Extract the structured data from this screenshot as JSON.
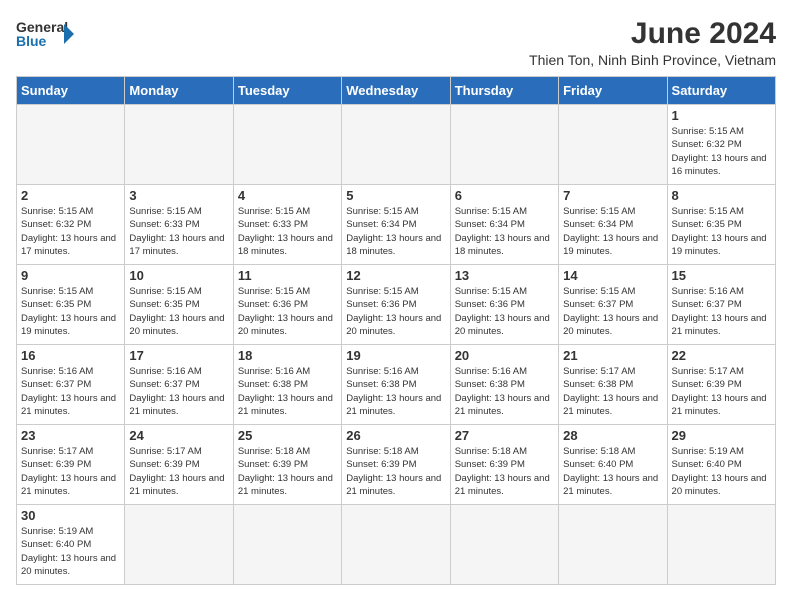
{
  "header": {
    "logo_general": "General",
    "logo_blue": "Blue",
    "title": "June 2024",
    "subtitle": "Thien Ton, Ninh Binh Province, Vietnam"
  },
  "days_of_week": [
    "Sunday",
    "Monday",
    "Tuesday",
    "Wednesday",
    "Thursday",
    "Friday",
    "Saturday"
  ],
  "weeks": [
    [
      {
        "day": "",
        "info": ""
      },
      {
        "day": "",
        "info": ""
      },
      {
        "day": "",
        "info": ""
      },
      {
        "day": "",
        "info": ""
      },
      {
        "day": "",
        "info": ""
      },
      {
        "day": "",
        "info": ""
      },
      {
        "day": "1",
        "info": "Sunrise: 5:15 AM\nSunset: 6:32 PM\nDaylight: 13 hours and 16 minutes."
      }
    ],
    [
      {
        "day": "2",
        "info": "Sunrise: 5:15 AM\nSunset: 6:32 PM\nDaylight: 13 hours and 17 minutes."
      },
      {
        "day": "3",
        "info": "Sunrise: 5:15 AM\nSunset: 6:33 PM\nDaylight: 13 hours and 17 minutes."
      },
      {
        "day": "4",
        "info": "Sunrise: 5:15 AM\nSunset: 6:33 PM\nDaylight: 13 hours and 18 minutes."
      },
      {
        "day": "5",
        "info": "Sunrise: 5:15 AM\nSunset: 6:34 PM\nDaylight: 13 hours and 18 minutes."
      },
      {
        "day": "6",
        "info": "Sunrise: 5:15 AM\nSunset: 6:34 PM\nDaylight: 13 hours and 18 minutes."
      },
      {
        "day": "7",
        "info": "Sunrise: 5:15 AM\nSunset: 6:34 PM\nDaylight: 13 hours and 19 minutes."
      },
      {
        "day": "8",
        "info": "Sunrise: 5:15 AM\nSunset: 6:35 PM\nDaylight: 13 hours and 19 minutes."
      }
    ],
    [
      {
        "day": "9",
        "info": "Sunrise: 5:15 AM\nSunset: 6:35 PM\nDaylight: 13 hours and 19 minutes."
      },
      {
        "day": "10",
        "info": "Sunrise: 5:15 AM\nSunset: 6:35 PM\nDaylight: 13 hours and 20 minutes."
      },
      {
        "day": "11",
        "info": "Sunrise: 5:15 AM\nSunset: 6:36 PM\nDaylight: 13 hours and 20 minutes."
      },
      {
        "day": "12",
        "info": "Sunrise: 5:15 AM\nSunset: 6:36 PM\nDaylight: 13 hours and 20 minutes."
      },
      {
        "day": "13",
        "info": "Sunrise: 5:15 AM\nSunset: 6:36 PM\nDaylight: 13 hours and 20 minutes."
      },
      {
        "day": "14",
        "info": "Sunrise: 5:15 AM\nSunset: 6:37 PM\nDaylight: 13 hours and 20 minutes."
      },
      {
        "day": "15",
        "info": "Sunrise: 5:16 AM\nSunset: 6:37 PM\nDaylight: 13 hours and 21 minutes."
      }
    ],
    [
      {
        "day": "16",
        "info": "Sunrise: 5:16 AM\nSunset: 6:37 PM\nDaylight: 13 hours and 21 minutes."
      },
      {
        "day": "17",
        "info": "Sunrise: 5:16 AM\nSunset: 6:37 PM\nDaylight: 13 hours and 21 minutes."
      },
      {
        "day": "18",
        "info": "Sunrise: 5:16 AM\nSunset: 6:38 PM\nDaylight: 13 hours and 21 minutes."
      },
      {
        "day": "19",
        "info": "Sunrise: 5:16 AM\nSunset: 6:38 PM\nDaylight: 13 hours and 21 minutes."
      },
      {
        "day": "20",
        "info": "Sunrise: 5:16 AM\nSunset: 6:38 PM\nDaylight: 13 hours and 21 minutes."
      },
      {
        "day": "21",
        "info": "Sunrise: 5:17 AM\nSunset: 6:38 PM\nDaylight: 13 hours and 21 minutes."
      },
      {
        "day": "22",
        "info": "Sunrise: 5:17 AM\nSunset: 6:39 PM\nDaylight: 13 hours and 21 minutes."
      }
    ],
    [
      {
        "day": "23",
        "info": "Sunrise: 5:17 AM\nSunset: 6:39 PM\nDaylight: 13 hours and 21 minutes."
      },
      {
        "day": "24",
        "info": "Sunrise: 5:17 AM\nSunset: 6:39 PM\nDaylight: 13 hours and 21 minutes."
      },
      {
        "day": "25",
        "info": "Sunrise: 5:18 AM\nSunset: 6:39 PM\nDaylight: 13 hours and 21 minutes."
      },
      {
        "day": "26",
        "info": "Sunrise: 5:18 AM\nSunset: 6:39 PM\nDaylight: 13 hours and 21 minutes."
      },
      {
        "day": "27",
        "info": "Sunrise: 5:18 AM\nSunset: 6:39 PM\nDaylight: 13 hours and 21 minutes."
      },
      {
        "day": "28",
        "info": "Sunrise: 5:18 AM\nSunset: 6:40 PM\nDaylight: 13 hours and 21 minutes."
      },
      {
        "day": "29",
        "info": "Sunrise: 5:19 AM\nSunset: 6:40 PM\nDaylight: 13 hours and 20 minutes."
      }
    ],
    [
      {
        "day": "30",
        "info": "Sunrise: 5:19 AM\nSunset: 6:40 PM\nDaylight: 13 hours and 20 minutes."
      },
      {
        "day": "",
        "info": ""
      },
      {
        "day": "",
        "info": ""
      },
      {
        "day": "",
        "info": ""
      },
      {
        "day": "",
        "info": ""
      },
      {
        "day": "",
        "info": ""
      },
      {
        "day": "",
        "info": ""
      }
    ]
  ]
}
